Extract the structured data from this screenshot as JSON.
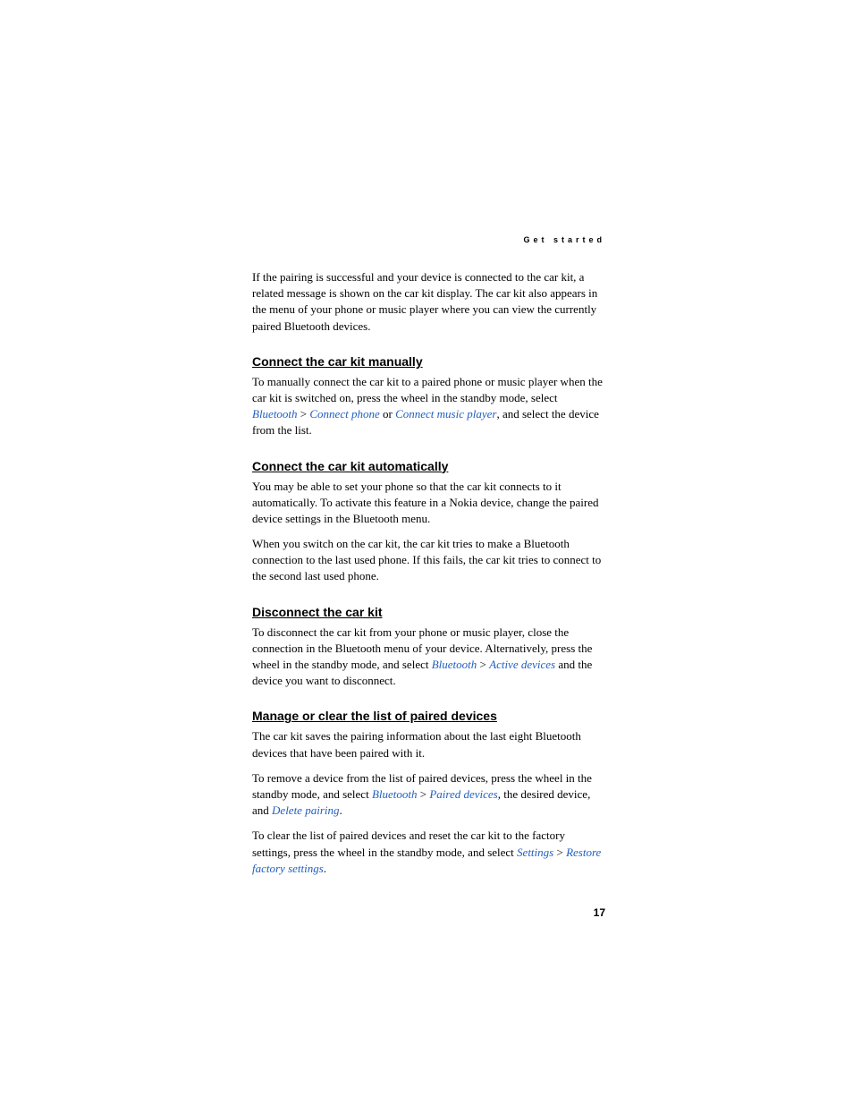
{
  "header": "Get started",
  "intro": "If the pairing is successful and your device is connected to the car kit, a related message is shown on the car kit display. The car kit also appears in the menu of your phone or music player where you can view the currently paired Bluetooth devices.",
  "s1": {
    "h": "Connect the car kit manually",
    "p1a": "To manually connect the car kit to a paired phone or music player when the car kit is switched on, press the wheel in the standby mode, select ",
    "m1": "Bluetooth",
    "sep1": " > ",
    "m2": "Connect phone",
    "mid": " or ",
    "m3": "Connect music player",
    "p1b": ", and select the device from the list."
  },
  "s2": {
    "h": "Connect the car kit automatically",
    "p1": "You may be able to set your phone so that the car kit connects to it automatically. To activate this feature in a Nokia device, change the paired device settings in the Bluetooth menu.",
    "p2": "When you switch on the car kit, the car kit tries to make a Bluetooth connection to the last used phone. If this fails, the car kit tries to connect to the second last used phone."
  },
  "s3": {
    "h": "Disconnect the car kit",
    "p1a": "To disconnect the car kit from your phone or music player, close the connection in the Bluetooth menu of your device. Alternatively, press the wheel in the standby mode, and select ",
    "m1": "Bluetooth",
    "sep1": " > ",
    "m2": "Active devices",
    "p1b": " and the device you want to disconnect."
  },
  "s4": {
    "h": "Manage or clear the list of paired devices",
    "p1": "The car kit saves the pairing information about the last eight Bluetooth devices that have been paired with it.",
    "p2a": "To remove a device from the list of paired devices, press the wheel in the standby mode, and select ",
    "m1": "Bluetooth",
    "sep1": " > ",
    "m2": "Paired devices",
    "p2b": ", the desired device, and ",
    "m3": "Delete pairing",
    "p2c": ".",
    "p3a": "To clear the list of paired devices and reset the car kit to the factory settings, press the wheel in the standby mode, and select ",
    "m4": "Settings",
    "sep2": " > ",
    "m5": "Restore factory settings",
    "p3b": "."
  },
  "pagenum": "17"
}
